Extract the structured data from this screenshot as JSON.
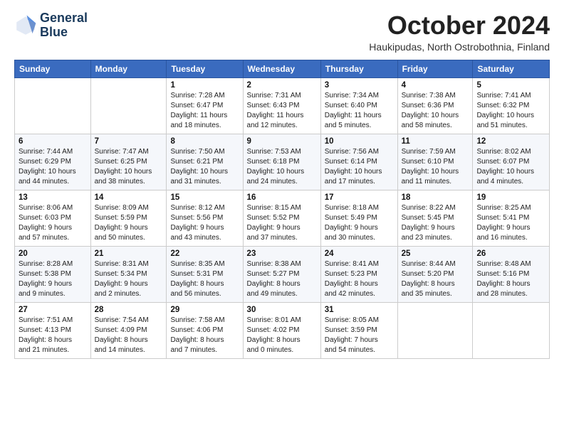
{
  "header": {
    "logo": {
      "line1": "General",
      "line2": "Blue"
    },
    "title": "October 2024",
    "subtitle": "Haukipudas, North Ostrobothnia, Finland"
  },
  "days_of_week": [
    "Sunday",
    "Monday",
    "Tuesday",
    "Wednesday",
    "Thursday",
    "Friday",
    "Saturday"
  ],
  "weeks": [
    [
      {
        "day": "",
        "info": ""
      },
      {
        "day": "",
        "info": ""
      },
      {
        "day": "1",
        "info": "Sunrise: 7:28 AM\nSunset: 6:47 PM\nDaylight: 11 hours\nand 18 minutes."
      },
      {
        "day": "2",
        "info": "Sunrise: 7:31 AM\nSunset: 6:43 PM\nDaylight: 11 hours\nand 12 minutes."
      },
      {
        "day": "3",
        "info": "Sunrise: 7:34 AM\nSunset: 6:40 PM\nDaylight: 11 hours\nand 5 minutes."
      },
      {
        "day": "4",
        "info": "Sunrise: 7:38 AM\nSunset: 6:36 PM\nDaylight: 10 hours\nand 58 minutes."
      },
      {
        "day": "5",
        "info": "Sunrise: 7:41 AM\nSunset: 6:32 PM\nDaylight: 10 hours\nand 51 minutes."
      }
    ],
    [
      {
        "day": "6",
        "info": "Sunrise: 7:44 AM\nSunset: 6:29 PM\nDaylight: 10 hours\nand 44 minutes."
      },
      {
        "day": "7",
        "info": "Sunrise: 7:47 AM\nSunset: 6:25 PM\nDaylight: 10 hours\nand 38 minutes."
      },
      {
        "day": "8",
        "info": "Sunrise: 7:50 AM\nSunset: 6:21 PM\nDaylight: 10 hours\nand 31 minutes."
      },
      {
        "day": "9",
        "info": "Sunrise: 7:53 AM\nSunset: 6:18 PM\nDaylight: 10 hours\nand 24 minutes."
      },
      {
        "day": "10",
        "info": "Sunrise: 7:56 AM\nSunset: 6:14 PM\nDaylight: 10 hours\nand 17 minutes."
      },
      {
        "day": "11",
        "info": "Sunrise: 7:59 AM\nSunset: 6:10 PM\nDaylight: 10 hours\nand 11 minutes."
      },
      {
        "day": "12",
        "info": "Sunrise: 8:02 AM\nSunset: 6:07 PM\nDaylight: 10 hours\nand 4 minutes."
      }
    ],
    [
      {
        "day": "13",
        "info": "Sunrise: 8:06 AM\nSunset: 6:03 PM\nDaylight: 9 hours\nand 57 minutes."
      },
      {
        "day": "14",
        "info": "Sunrise: 8:09 AM\nSunset: 5:59 PM\nDaylight: 9 hours\nand 50 minutes."
      },
      {
        "day": "15",
        "info": "Sunrise: 8:12 AM\nSunset: 5:56 PM\nDaylight: 9 hours\nand 43 minutes."
      },
      {
        "day": "16",
        "info": "Sunrise: 8:15 AM\nSunset: 5:52 PM\nDaylight: 9 hours\nand 37 minutes."
      },
      {
        "day": "17",
        "info": "Sunrise: 8:18 AM\nSunset: 5:49 PM\nDaylight: 9 hours\nand 30 minutes."
      },
      {
        "day": "18",
        "info": "Sunrise: 8:22 AM\nSunset: 5:45 PM\nDaylight: 9 hours\nand 23 minutes."
      },
      {
        "day": "19",
        "info": "Sunrise: 8:25 AM\nSunset: 5:41 PM\nDaylight: 9 hours\nand 16 minutes."
      }
    ],
    [
      {
        "day": "20",
        "info": "Sunrise: 8:28 AM\nSunset: 5:38 PM\nDaylight: 9 hours\nand 9 minutes."
      },
      {
        "day": "21",
        "info": "Sunrise: 8:31 AM\nSunset: 5:34 PM\nDaylight: 9 hours\nand 2 minutes."
      },
      {
        "day": "22",
        "info": "Sunrise: 8:35 AM\nSunset: 5:31 PM\nDaylight: 8 hours\nand 56 minutes."
      },
      {
        "day": "23",
        "info": "Sunrise: 8:38 AM\nSunset: 5:27 PM\nDaylight: 8 hours\nand 49 minutes."
      },
      {
        "day": "24",
        "info": "Sunrise: 8:41 AM\nSunset: 5:23 PM\nDaylight: 8 hours\nand 42 minutes."
      },
      {
        "day": "25",
        "info": "Sunrise: 8:44 AM\nSunset: 5:20 PM\nDaylight: 8 hours\nand 35 minutes."
      },
      {
        "day": "26",
        "info": "Sunrise: 8:48 AM\nSunset: 5:16 PM\nDaylight: 8 hours\nand 28 minutes."
      }
    ],
    [
      {
        "day": "27",
        "info": "Sunrise: 7:51 AM\nSunset: 4:13 PM\nDaylight: 8 hours\nand 21 minutes."
      },
      {
        "day": "28",
        "info": "Sunrise: 7:54 AM\nSunset: 4:09 PM\nDaylight: 8 hours\nand 14 minutes."
      },
      {
        "day": "29",
        "info": "Sunrise: 7:58 AM\nSunset: 4:06 PM\nDaylight: 8 hours\nand 7 minutes."
      },
      {
        "day": "30",
        "info": "Sunrise: 8:01 AM\nSunset: 4:02 PM\nDaylight: 8 hours\nand 0 minutes."
      },
      {
        "day": "31",
        "info": "Sunrise: 8:05 AM\nSunset: 3:59 PM\nDaylight: 7 hours\nand 54 minutes."
      },
      {
        "day": "",
        "info": ""
      },
      {
        "day": "",
        "info": ""
      }
    ]
  ]
}
